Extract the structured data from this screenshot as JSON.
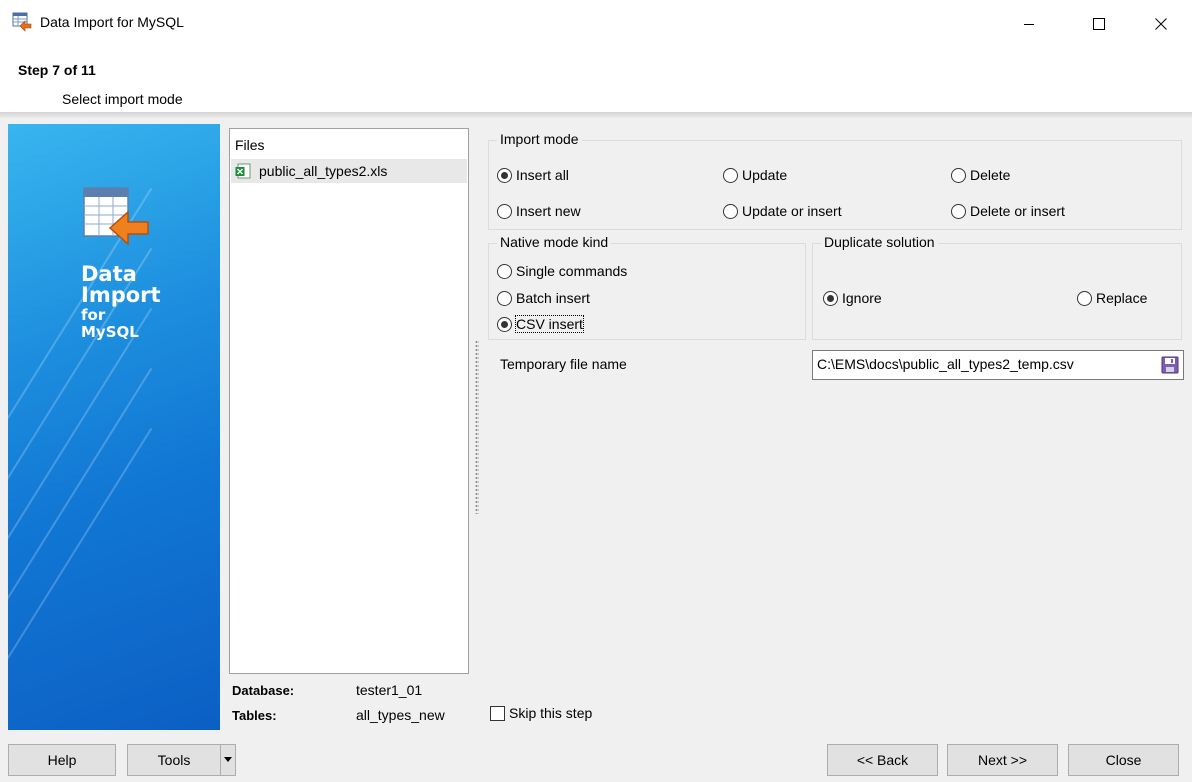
{
  "window": {
    "title": "Data Import for MySQL",
    "icons": {
      "app": "data-import-icon",
      "minimize": "minimize-icon",
      "maximize": "maximize-icon",
      "close": "close-icon"
    }
  },
  "header": {
    "step": "Step 7 of 11",
    "subtitle": "Select import mode"
  },
  "banner": {
    "line1": "Data",
    "line2": "Import",
    "line3": "for",
    "line4": "MySQL",
    "icon": "table-import-icon"
  },
  "files": {
    "header": "Files",
    "items": [
      {
        "name": "public_all_types2.xls",
        "icon": "excel-file-icon"
      }
    ]
  },
  "info": {
    "database_label": "Database:",
    "database_value": "tester1_01",
    "tables_label": "Tables:",
    "tables_value": "all_types_new"
  },
  "import_mode": {
    "legend": "Import mode",
    "selected": "Insert all",
    "options": [
      "Insert all",
      "Update",
      "Delete",
      "Insert new",
      "Update or insert",
      "Delete or insert"
    ]
  },
  "native_mode": {
    "legend": "Native mode kind",
    "selected": "CSV insert",
    "options": [
      "Single commands",
      "Batch insert",
      "CSV insert"
    ]
  },
  "duplicate": {
    "legend": "Duplicate solution",
    "selected": "Ignore",
    "options": [
      "Ignore",
      "Replace"
    ]
  },
  "temp_file": {
    "label": "Temporary file name",
    "value": "C:\\EMS\\docs\\public_all_types2_temp.csv",
    "icon": "save-icon"
  },
  "skip": {
    "label": "Skip this step",
    "checked": false
  },
  "footer": {
    "help": "Help",
    "tools": "Tools",
    "back": "<< Back",
    "next": "Next >>",
    "close": "Close"
  }
}
